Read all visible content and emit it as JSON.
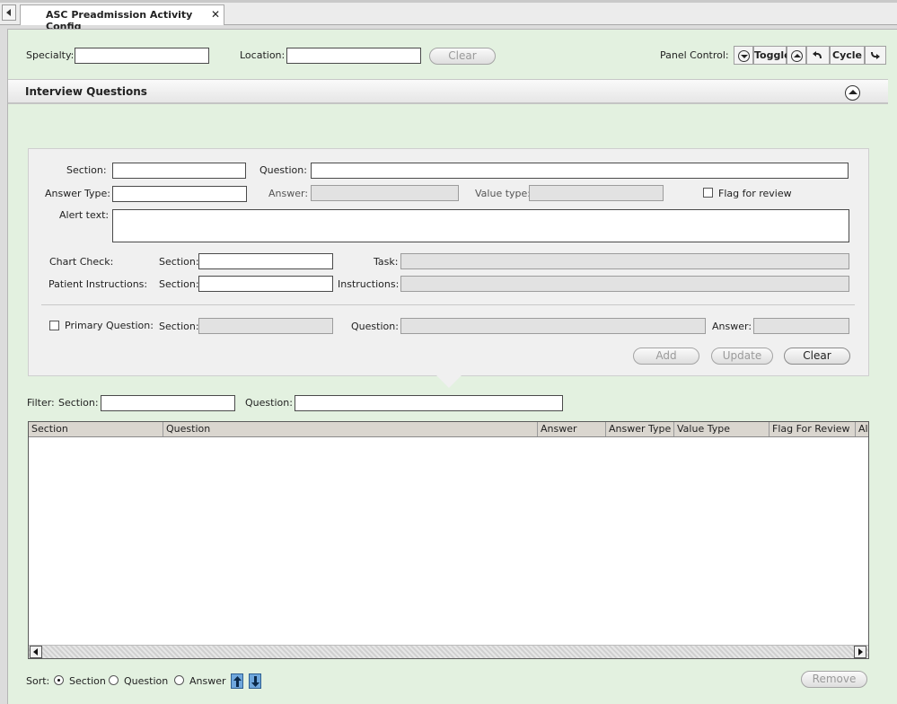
{
  "tab": {
    "title": "ASC Preadmission Activity Config",
    "close": "✕"
  },
  "filters": {
    "specialty_label": "Specialty:",
    "specialty_value": "",
    "location_label": "Location:",
    "location_value": "",
    "clear_label": "Clear"
  },
  "panel_control": {
    "label": "Panel Control:",
    "toggle": "Toggle",
    "cycle": "Cycle",
    "icons": [
      "circle-down-icon",
      "circle-up-icon",
      "undo-icon",
      "redo-icon"
    ]
  },
  "section": {
    "title": "Interview Questions"
  },
  "form": {
    "section_label": "Section:",
    "section_value": "",
    "question_label": "Question:",
    "question_value": "",
    "answer_type_label": "Answer Type:",
    "answer_type_value": "",
    "answer_label": "Answer:",
    "answer_value": "",
    "value_type_label": "Value type:",
    "value_type_value": "",
    "flag_label": "Flag for review",
    "flag_checked": false,
    "alert_label": "Alert text:",
    "alert_value": "",
    "chart_check_label": "Chart Check:",
    "cc_section_label": "Section:",
    "cc_section_value": "",
    "task_label": "Task:",
    "task_value": "",
    "pi_label": "Patient Instructions:",
    "pi_section_label": "Section:",
    "pi_section_value": "",
    "instructions_label": "Instructions:",
    "instructions_value": "",
    "primary_label": "Primary Question:",
    "primary_checked": false,
    "pq_section_label": "Section:",
    "pq_section_value": "",
    "pq_question_label": "Question:",
    "pq_question_value": "",
    "pq_answer_label": "Answer:",
    "pq_answer_value": "",
    "add_label": "Add",
    "update_label": "Update",
    "clear_label": "Clear"
  },
  "filter": {
    "label": "Filter:",
    "section_label": "Section:",
    "section_value": "",
    "question_label": "Question:",
    "question_value": ""
  },
  "grid": {
    "columns": [
      "Section",
      "Question",
      "Answer",
      "Answer Type",
      "Value Type",
      "Flag For Review",
      "Al"
    ],
    "rows": []
  },
  "sort": {
    "label": "Sort:",
    "options": [
      "Section",
      "Question",
      "Answer"
    ],
    "selected": "Section",
    "remove_label": "Remove"
  }
}
